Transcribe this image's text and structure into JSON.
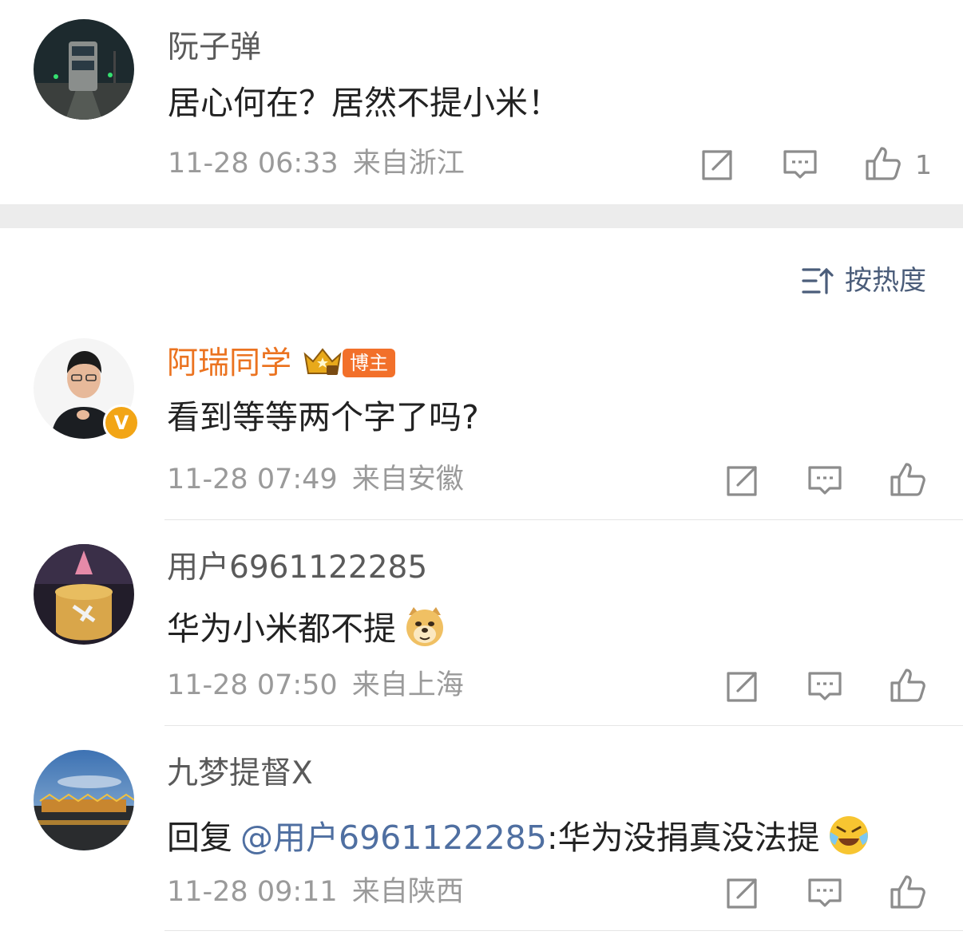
{
  "comments": [
    {
      "username": "阮子弹",
      "content": "居心何在？居然不提小米！",
      "time": "11-28 06:33",
      "location": "来自浙江",
      "likes": "1"
    },
    {
      "username": "阿瑞同学",
      "badge": "博主",
      "content": "看到等等两个字了吗?",
      "time": "11-28 07:49",
      "location": "来自安徽"
    },
    {
      "username": "用户6961122285",
      "content": "华为小米都不提",
      "emoji": "doge-emoji",
      "time": "11-28 07:50",
      "location": "来自上海"
    },
    {
      "username": "九梦提督X",
      "reply_prefix": "回复",
      "mention": "@用户6961122285",
      "content": ":华为没捐真没法提",
      "emoji": "laugh-cry-emoji",
      "time": "11-28 09:11",
      "location": "来自陕西"
    }
  ],
  "sort": {
    "label": "按热度",
    "icon": "sort-icon"
  },
  "icons": {
    "share": "share-icon",
    "comment": "comment-icon",
    "like": "thumbs-up-icon"
  },
  "colors": {
    "vip_name": "#eb7320",
    "mention": "#4f6fa1",
    "badge_bg": "#f2702a",
    "sort_text": "#4b5d7a"
  }
}
